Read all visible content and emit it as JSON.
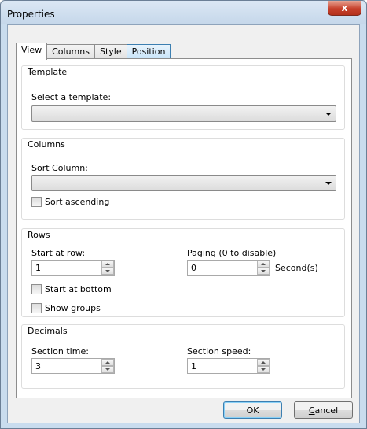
{
  "window": {
    "title": "Properties",
    "close_glyph": "x"
  },
  "tabs": [
    {
      "label": "View"
    },
    {
      "label": "Columns"
    },
    {
      "label": "Style"
    },
    {
      "label": "Position"
    }
  ],
  "template_group": {
    "title": "Template",
    "select_label": "Select a template:",
    "select_value": ""
  },
  "columns_group": {
    "title": "Columns",
    "sort_label": "Sort Column:",
    "sort_value": "",
    "sort_ascending_label": "Sort ascending",
    "sort_ascending_checked": false
  },
  "rows_group": {
    "title": "Rows",
    "start_row_label": "Start at row:",
    "start_row_value": "1",
    "paging_label": "Paging (0 to disable)",
    "paging_value": "0",
    "paging_unit": "Second(s)",
    "start_bottom_label": "Start at bottom",
    "start_bottom_checked": false,
    "show_groups_label": "Show groups",
    "show_groups_checked": false
  },
  "decimals_group": {
    "title": "Decimals",
    "section_time_label": "Section time:",
    "section_time_value": "3",
    "section_speed_label": "Section speed:",
    "section_speed_value": "1"
  },
  "buttons": {
    "ok": "OK",
    "cancel_first": "C",
    "cancel_rest": "ancel"
  },
  "colors": {
    "accent": "#3c7fb1",
    "close": "#c7412c",
    "frame": "#c9dcee"
  }
}
